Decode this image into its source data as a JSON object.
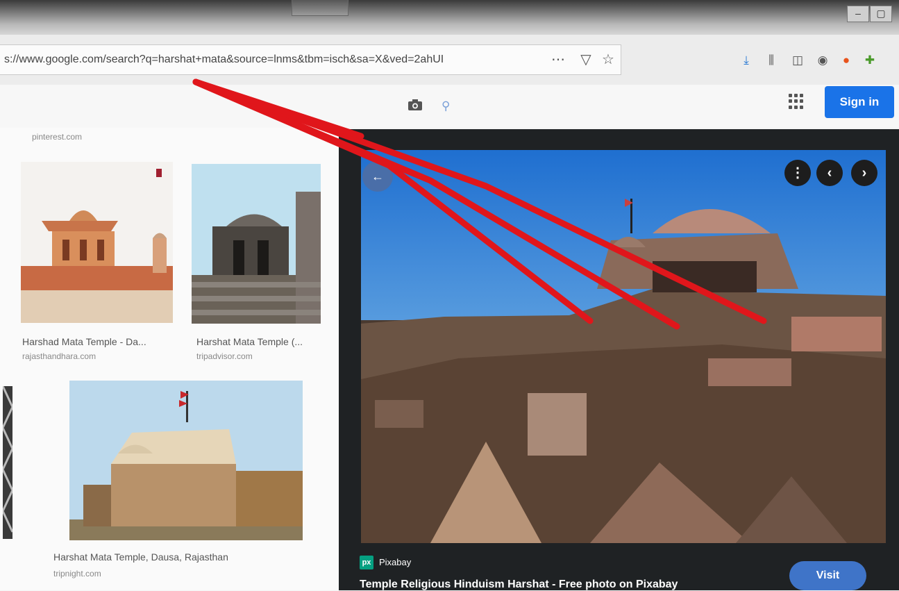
{
  "browser": {
    "url": "s://www.google.com/search?q=harshat+mata&source=lnms&tbm=isch&sa=X&ved=2ahUI",
    "url_icons": [
      "more-icon",
      "pocket-icon",
      "bookmark-star-icon"
    ],
    "more_glyph": "⋯",
    "pocket_glyph": "▽",
    "star_glyph": "☆",
    "toolbar_icons": [
      "download-icon",
      "library-icon",
      "sidebar-icon",
      "account-icon",
      "addon-icon",
      "extension-icon"
    ]
  },
  "google": {
    "sign_in": "Sign in"
  },
  "results": {
    "top_source": "pinterest.com",
    "items": [
      {
        "title": "Harshad Mata Temple - Da...",
        "source": "rajasthandhara.com"
      },
      {
        "title": "Harshat Mata Temple (...",
        "source": "tripadvisor.com"
      },
      {
        "title": "Harshat Mata Temple, Dausa, Rajasthan",
        "source": "tripnight.com"
      }
    ]
  },
  "preview": {
    "site": "Pixabay",
    "site_logo": "px",
    "title": "Temple Religious Hinduism Harshat - Free photo on Pixabay",
    "visit": "Visit",
    "more_glyph": "⋮",
    "prev_glyph": "‹",
    "next_glyph": "›"
  },
  "colors": {
    "accent": "#1a73e8",
    "annotation": "#e0161b"
  }
}
